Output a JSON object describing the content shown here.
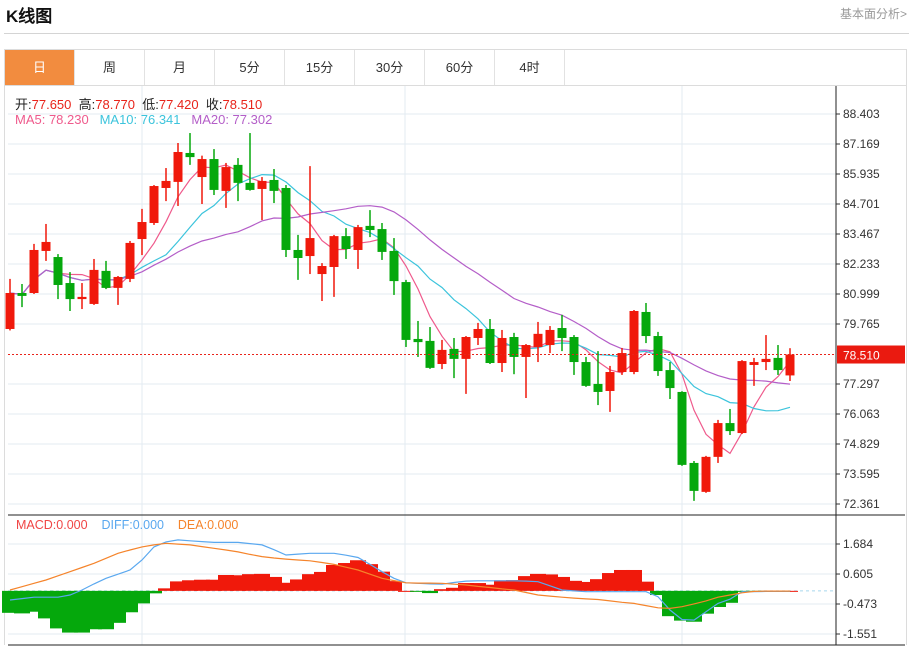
{
  "header": {
    "title": "K线图",
    "link": "基本面分析>"
  },
  "tabs": [
    {
      "label": "日",
      "active": true
    },
    {
      "label": "周"
    },
    {
      "label": "月"
    },
    {
      "label": "5分"
    },
    {
      "label": "15分"
    },
    {
      "label": "30分"
    },
    {
      "label": "60分"
    },
    {
      "label": "4时"
    }
  ],
  "ohlc_legend": {
    "open_label": "开:",
    "open": "77.650",
    "high_label": "高:",
    "high": "78.770",
    "low_label": "低:",
    "low": "77.420",
    "close_label": "收:",
    "close": "78.510"
  },
  "ma_legend": {
    "ma5": "MA5: 78.230",
    "ma10": "MA10: 76.341",
    "ma20": "MA20: 77.302"
  },
  "macd_legend": {
    "macd": "MACD:0.000",
    "diff": "DIFF:0.000",
    "dea": "DEA:0.000"
  },
  "colors": {
    "up": "#f0190b",
    "down": "#05a80c",
    "ma5": "#ef5a8c",
    "ma10": "#3cc4dc",
    "ma20": "#b45ec8",
    "diff": "#5aa8ef",
    "dea": "#f5842b",
    "accent": "#f28c3f"
  },
  "chart_data": [
    {
      "type": "candlestick",
      "title": "K线图",
      "ylim": [
        72.361,
        88.403
      ],
      "yticks": [
        "88.403",
        "87.169",
        "85.935",
        "84.701",
        "83.467",
        "82.233",
        "80.999",
        "79.765",
        "77.297",
        "76.063",
        "74.829",
        "73.595",
        "72.361"
      ],
      "last_price": "78.510",
      "ohlc": [
        [
          79.56,
          81.62,
          79.5,
          81.04
        ],
        [
          81.04,
          81.41,
          80.46,
          80.92
        ],
        [
          81.04,
          83.06,
          81.0,
          82.81
        ],
        [
          82.77,
          83.88,
          82.36,
          83.14
        ],
        [
          82.52,
          82.64,
          80.79,
          81.37
        ],
        [
          81.45,
          81.9,
          80.3,
          80.79
        ],
        [
          80.79,
          81.45,
          80.38,
          80.88
        ],
        [
          80.59,
          82.44,
          80.55,
          81.99
        ],
        [
          81.95,
          82.36,
          81.2,
          81.25
        ],
        [
          81.25,
          81.74,
          80.55,
          81.7
        ],
        [
          81.62,
          83.18,
          81.49,
          83.1
        ],
        [
          83.26,
          84.5,
          82.6,
          83.96
        ],
        [
          83.92,
          85.48,
          83.84,
          85.44
        ],
        [
          85.36,
          86.18,
          84.82,
          85.65
        ],
        [
          85.61,
          87.21,
          84.62,
          86.84
        ],
        [
          86.8,
          87.62,
          86.31,
          86.63
        ],
        [
          85.81,
          86.69,
          84.7,
          86.55
        ],
        [
          86.55,
          86.96,
          85.07,
          85.28
        ],
        [
          85.24,
          86.39,
          84.54,
          86.22
        ],
        [
          86.31,
          86.59,
          84.82,
          85.57
        ],
        [
          85.57,
          87.62,
          85.25,
          85.28
        ],
        [
          85.32,
          85.81,
          84.04,
          85.65
        ],
        [
          85.69,
          86.14,
          84.74,
          85.24
        ],
        [
          85.36,
          85.48,
          82.52,
          82.81
        ],
        [
          82.81,
          83.43,
          81.58,
          82.48
        ],
        [
          82.56,
          86.26,
          81.82,
          83.3
        ],
        [
          81.82,
          82.27,
          80.71,
          82.15
        ],
        [
          82.11,
          83.43,
          80.88,
          83.38
        ],
        [
          83.38,
          83.71,
          82.44,
          82.85
        ],
        [
          82.81,
          83.84,
          82.03,
          83.75
        ],
        [
          83.8,
          84.45,
          83.34,
          83.63
        ],
        [
          83.67,
          83.92,
          82.4,
          82.73
        ],
        [
          82.77,
          83.3,
          80.96,
          81.53
        ],
        [
          81.49,
          81.58,
          78.82,
          79.11
        ],
        [
          79.15,
          79.89,
          78.41,
          79.02
        ],
        [
          79.07,
          79.64,
          77.92,
          77.96
        ],
        [
          78.12,
          79.11,
          77.91,
          78.7
        ],
        [
          78.74,
          79.19,
          77.54,
          78.33
        ],
        [
          78.33,
          79.27,
          76.89,
          79.23
        ],
        [
          79.19,
          79.81,
          78.9,
          79.56
        ],
        [
          79.56,
          79.97,
          78.12,
          78.16
        ],
        [
          78.16,
          79.52,
          77.79,
          79.19
        ],
        [
          79.23,
          79.4,
          77.7,
          78.41
        ],
        [
          78.41,
          78.94,
          76.72,
          78.9
        ],
        [
          78.82,
          79.85,
          78.2,
          79.36
        ],
        [
          78.9,
          79.68,
          78.57,
          79.52
        ],
        [
          79.6,
          80.14,
          78.65,
          79.19
        ],
        [
          79.23,
          79.31,
          77.67,
          78.2
        ],
        [
          78.2,
          78.41,
          77.18,
          77.22
        ],
        [
          77.3,
          78.65,
          76.43,
          76.97
        ],
        [
          77.01,
          78.04,
          76.15,
          77.79
        ],
        [
          77.79,
          78.78,
          77.67,
          78.57
        ],
        [
          77.79,
          80.34,
          77.7,
          80.3
        ],
        [
          80.26,
          80.63,
          78.98,
          79.27
        ],
        [
          79.27,
          79.44,
          77.63,
          77.83
        ],
        [
          77.87,
          78.2,
          76.68,
          77.13
        ],
        [
          76.97,
          77.0,
          73.93,
          73.97
        ],
        [
          74.05,
          74.13,
          72.49,
          72.9
        ],
        [
          72.86,
          74.34,
          72.82,
          74.3
        ],
        [
          74.3,
          75.82,
          74.05,
          75.69
        ],
        [
          75.69,
          76.27,
          75.2,
          75.36
        ],
        [
          75.28,
          78.28,
          75.24,
          78.24
        ],
        [
          78.08,
          78.37,
          77.22,
          78.2
        ],
        [
          78.2,
          79.31,
          77.87,
          78.33
        ],
        [
          78.37,
          78.9,
          77.67,
          77.87
        ],
        [
          77.65,
          78.77,
          77.42,
          78.51
        ]
      ],
      "ma_periods": [
        5,
        10,
        20
      ]
    },
    {
      "type": "bar+line",
      "title": "MACD",
      "ylim": [
        -1.551,
        1.684
      ],
      "yticks": [
        "1.684",
        "0.605",
        "-0.473",
        "-1.551"
      ],
      "macd": [
        -0.79,
        -0.81,
        -0.75,
        -0.99,
        -1.35,
        -1.5,
        -1.5,
        -1.38,
        -1.38,
        -1.15,
        -0.77,
        -0.45,
        -0.09,
        0.09,
        0.34,
        0.38,
        0.4,
        0.4,
        0.57,
        0.56,
        0.6,
        0.61,
        0.5,
        0.29,
        0.41,
        0.6,
        0.68,
        0.93,
        1.0,
        1.1,
        0.96,
        0.69,
        0.35,
        0.0,
        -0.02,
        -0.08,
        0.06,
        0.11,
        0.28,
        0.28,
        0.22,
        0.38,
        0.39,
        0.53,
        0.61,
        0.59,
        0.5,
        0.36,
        0.32,
        0.42,
        0.64,
        0.75,
        0.75,
        0.33,
        -0.15,
        -0.91,
        -1.07,
        -1.11,
        -0.82,
        -0.58,
        -0.43,
        -0.03,
        -0.02,
        -0.02,
        -0.01,
        0.0
      ],
      "diff": [
        -0.33,
        -0.28,
        -0.23,
        -0.23,
        -0.23,
        -0.15,
        0.03,
        0.25,
        0.45,
        0.6,
        0.75,
        1.11,
        1.58,
        1.76,
        1.83,
        1.8,
        1.77,
        1.74,
        1.74,
        1.74,
        1.7,
        1.65,
        1.48,
        1.29,
        1.32,
        1.35,
        1.35,
        1.35,
        1.28,
        1.2,
        0.95,
        0.69,
        0.45,
        0.29,
        0.27,
        0.25,
        0.24,
        0.3,
        0.35,
        0.36,
        0.36,
        0.36,
        0.36,
        0.35,
        0.33,
        0.18,
        0.03,
        0.0,
        -0.03,
        -0.03,
        -0.03,
        -0.03,
        -0.03,
        -0.03,
        -0.21,
        -0.69,
        -1.03,
        -1.05,
        -0.75,
        -0.45,
        -0.3,
        -0.03,
        -0.03,
        -0.02,
        -0.02,
        -0.02
      ],
      "dea": [
        0.03,
        0.15,
        0.27,
        0.39,
        0.54,
        0.69,
        0.84,
        0.99,
        1.17,
        1.35,
        1.47,
        1.58,
        1.65,
        1.71,
        1.68,
        1.65,
        1.59,
        1.53,
        1.47,
        1.4,
        1.31,
        1.23,
        1.18,
        1.14,
        1.11,
        1.08,
        1.02,
        0.95,
        0.85,
        0.75,
        0.6,
        0.45,
        0.37,
        0.29,
        0.28,
        0.28,
        0.27,
        0.24,
        0.21,
        0.16,
        0.12,
        0.07,
        0.03,
        -0.06,
        -0.15,
        -0.19,
        -0.23,
        -0.26,
        -0.29,
        -0.31,
        -0.36,
        -0.41,
        -0.45,
        -0.53,
        -0.61,
        -0.63,
        -0.57,
        -0.47,
        -0.36,
        -0.23,
        -0.15,
        -0.07,
        -0.02,
        -0.01,
        -0.01,
        -0.01
      ]
    }
  ]
}
